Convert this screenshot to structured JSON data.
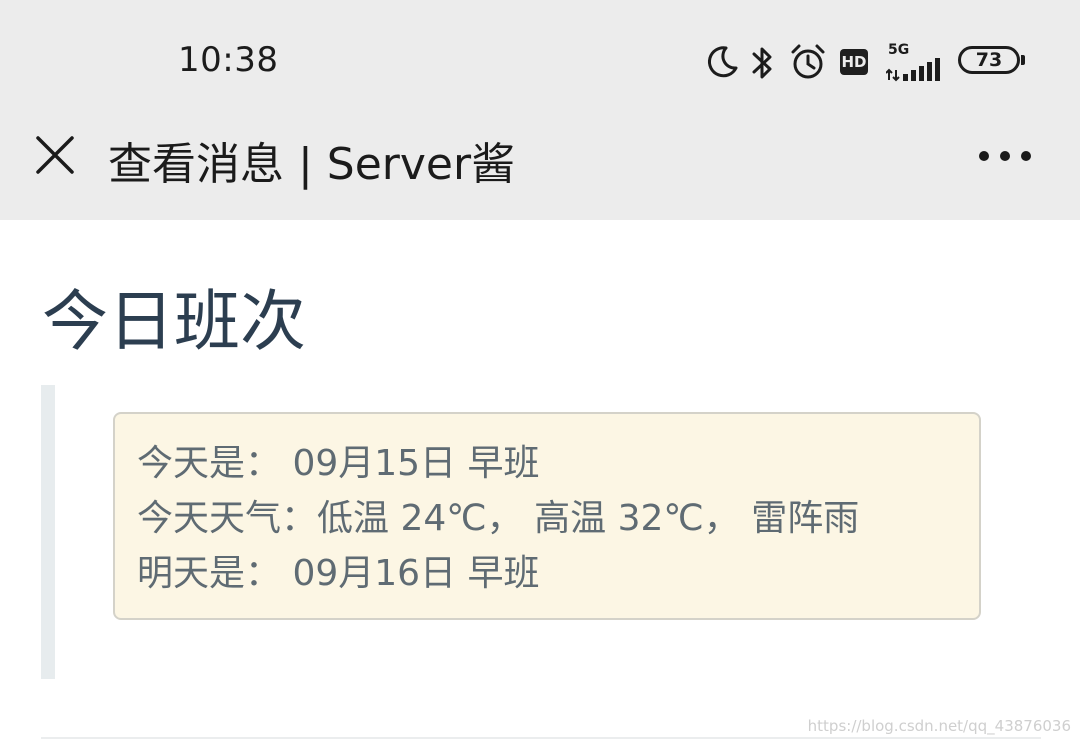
{
  "status_bar": {
    "time": "10:38",
    "network_label": "5G",
    "badge_hd": "HD",
    "battery_level": "73",
    "icons": [
      "moon-icon",
      "bluetooth-icon",
      "alarm-icon",
      "hd-icon",
      "signal-icon",
      "battery-icon"
    ]
  },
  "nav": {
    "title": "查看消息 | Server酱",
    "close_icon": "close-icon",
    "more_icon": "more-icon"
  },
  "content": {
    "heading": "今日班次",
    "lines": [
      "今天是： 09月15日  早班",
      "今天天气：低温  24℃， 高温  32℃， 雷阵雨",
      "明天是： 09月16日  早班"
    ]
  },
  "watermark": "https://blog.csdn.net/qq_43876036",
  "colors": {
    "top_bar_bg": "#ececec",
    "heading": "#2c3e50",
    "box_bg": "#fcf6e4",
    "box_border": "#d4d2c9",
    "box_text": "#5f6b73",
    "quote_bar": "#e7ecee"
  }
}
